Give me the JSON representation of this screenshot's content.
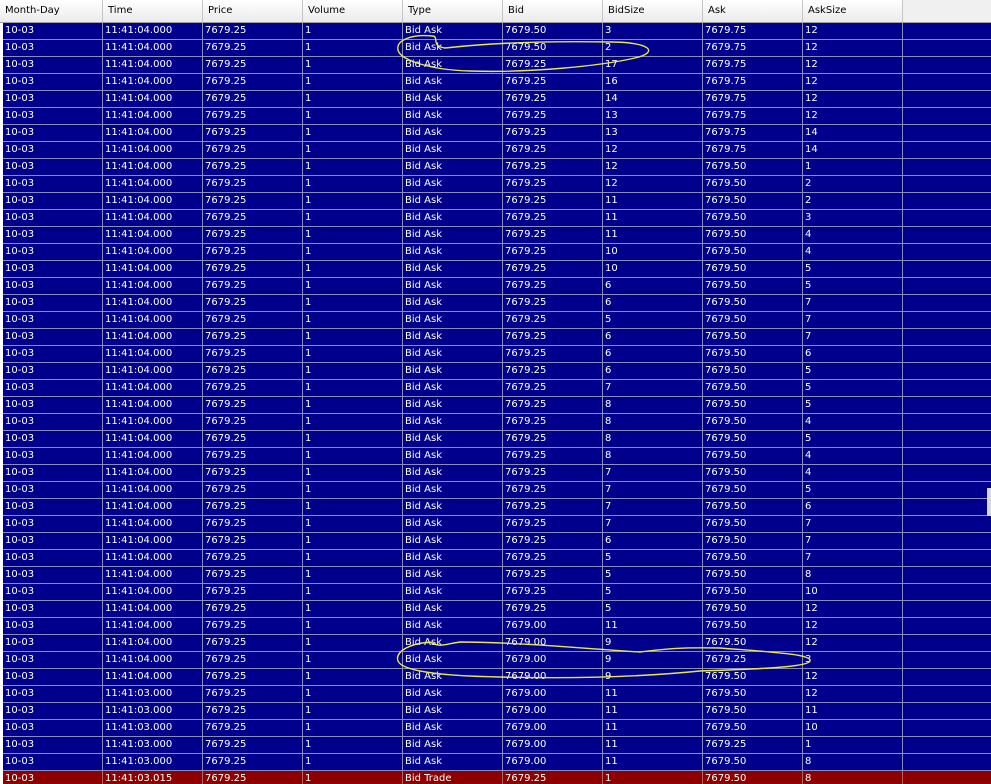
{
  "colors": {
    "row_bg": "#00008c",
    "trade_row_bg": "#8c0000",
    "text": "#ffffff",
    "header_bg": "#f0f0f0",
    "annotation": "#e8e84a"
  },
  "columns": [
    "Month-Day",
    "Time",
    "Price",
    "Volume",
    "Type",
    "Bid",
    "BidSize",
    "Ask",
    "AskSize"
  ],
  "rows": [
    [
      "10-03",
      "11:41:04.000",
      "7679.25",
      "1",
      "Bid Ask",
      "7679.50",
      "3",
      "7679.75",
      "12"
    ],
    [
      "10-03",
      "11:41:04.000",
      "7679.25",
      "1",
      "Bid Ask",
      "7679.50",
      "2",
      "7679.75",
      "12"
    ],
    [
      "10-03",
      "11:41:04.000",
      "7679.25",
      "1",
      "Bid Ask",
      "7679.25",
      "17",
      "7679.75",
      "12"
    ],
    [
      "10-03",
      "11:41:04.000",
      "7679.25",
      "1",
      "Bid Ask",
      "7679.25",
      "16",
      "7679.75",
      "12"
    ],
    [
      "10-03",
      "11:41:04.000",
      "7679.25",
      "1",
      "Bid Ask",
      "7679.25",
      "14",
      "7679.75",
      "12"
    ],
    [
      "10-03",
      "11:41:04.000",
      "7679.25",
      "1",
      "Bid Ask",
      "7679.25",
      "13",
      "7679.75",
      "12"
    ],
    [
      "10-03",
      "11:41:04.000",
      "7679.25",
      "1",
      "Bid Ask",
      "7679.25",
      "13",
      "7679.75",
      "14"
    ],
    [
      "10-03",
      "11:41:04.000",
      "7679.25",
      "1",
      "Bid Ask",
      "7679.25",
      "12",
      "7679.75",
      "14"
    ],
    [
      "10-03",
      "11:41:04.000",
      "7679.25",
      "1",
      "Bid Ask",
      "7679.25",
      "12",
      "7679.50",
      "1"
    ],
    [
      "10-03",
      "11:41:04.000",
      "7679.25",
      "1",
      "Bid Ask",
      "7679.25",
      "12",
      "7679.50",
      "2"
    ],
    [
      "10-03",
      "11:41:04.000",
      "7679.25",
      "1",
      "Bid Ask",
      "7679.25",
      "11",
      "7679.50",
      "2"
    ],
    [
      "10-03",
      "11:41:04.000",
      "7679.25",
      "1",
      "Bid Ask",
      "7679.25",
      "11",
      "7679.50",
      "3"
    ],
    [
      "10-03",
      "11:41:04.000",
      "7679.25",
      "1",
      "Bid Ask",
      "7679.25",
      "11",
      "7679.50",
      "4"
    ],
    [
      "10-03",
      "11:41:04.000",
      "7679.25",
      "1",
      "Bid Ask",
      "7679.25",
      "10",
      "7679.50",
      "4"
    ],
    [
      "10-03",
      "11:41:04.000",
      "7679.25",
      "1",
      "Bid Ask",
      "7679.25",
      "10",
      "7679.50",
      "5"
    ],
    [
      "10-03",
      "11:41:04.000",
      "7679.25",
      "1",
      "Bid Ask",
      "7679.25",
      "6",
      "7679.50",
      "5"
    ],
    [
      "10-03",
      "11:41:04.000",
      "7679.25",
      "1",
      "Bid Ask",
      "7679.25",
      "6",
      "7679.50",
      "7"
    ],
    [
      "10-03",
      "11:41:04.000",
      "7679.25",
      "1",
      "Bid Ask",
      "7679.25",
      "5",
      "7679.50",
      "7"
    ],
    [
      "10-03",
      "11:41:04.000",
      "7679.25",
      "1",
      "Bid Ask",
      "7679.25",
      "6",
      "7679.50",
      "7"
    ],
    [
      "10-03",
      "11:41:04.000",
      "7679.25",
      "1",
      "Bid Ask",
      "7679.25",
      "6",
      "7679.50",
      "6"
    ],
    [
      "10-03",
      "11:41:04.000",
      "7679.25",
      "1",
      "Bid Ask",
      "7679.25",
      "6",
      "7679.50",
      "5"
    ],
    [
      "10-03",
      "11:41:04.000",
      "7679.25",
      "1",
      "Bid Ask",
      "7679.25",
      "7",
      "7679.50",
      "5"
    ],
    [
      "10-03",
      "11:41:04.000",
      "7679.25",
      "1",
      "Bid Ask",
      "7679.25",
      "8",
      "7679.50",
      "5"
    ],
    [
      "10-03",
      "11:41:04.000",
      "7679.25",
      "1",
      "Bid Ask",
      "7679.25",
      "8",
      "7679.50",
      "4"
    ],
    [
      "10-03",
      "11:41:04.000",
      "7679.25",
      "1",
      "Bid Ask",
      "7679.25",
      "8",
      "7679.50",
      "5"
    ],
    [
      "10-03",
      "11:41:04.000",
      "7679.25",
      "1",
      "Bid Ask",
      "7679.25",
      "8",
      "7679.50",
      "4"
    ],
    [
      "10-03",
      "11:41:04.000",
      "7679.25",
      "1",
      "Bid Ask",
      "7679.25",
      "7",
      "7679.50",
      "4"
    ],
    [
      "10-03",
      "11:41:04.000",
      "7679.25",
      "1",
      "Bid Ask",
      "7679.25",
      "7",
      "7679.50",
      "5"
    ],
    [
      "10-03",
      "11:41:04.000",
      "7679.25",
      "1",
      "Bid Ask",
      "7679.25",
      "7",
      "7679.50",
      "6"
    ],
    [
      "10-03",
      "11:41:04.000",
      "7679.25",
      "1",
      "Bid Ask",
      "7679.25",
      "7",
      "7679.50",
      "7"
    ],
    [
      "10-03",
      "11:41:04.000",
      "7679.25",
      "1",
      "Bid Ask",
      "7679.25",
      "6",
      "7679.50",
      "7"
    ],
    [
      "10-03",
      "11:41:04.000",
      "7679.25",
      "1",
      "Bid Ask",
      "7679.25",
      "5",
      "7679.50",
      "7"
    ],
    [
      "10-03",
      "11:41:04.000",
      "7679.25",
      "1",
      "Bid Ask",
      "7679.25",
      "5",
      "7679.50",
      "8"
    ],
    [
      "10-03",
      "11:41:04.000",
      "7679.25",
      "1",
      "Bid Ask",
      "7679.25",
      "5",
      "7679.50",
      "10"
    ],
    [
      "10-03",
      "11:41:04.000",
      "7679.25",
      "1",
      "Bid Ask",
      "7679.25",
      "5",
      "7679.50",
      "12"
    ],
    [
      "10-03",
      "11:41:04.000",
      "7679.25",
      "1",
      "Bid Ask",
      "7679.00",
      "11",
      "7679.50",
      "12"
    ],
    [
      "10-03",
      "11:41:04.000",
      "7679.25",
      "1",
      "Bid Ask",
      "7679.00",
      "9",
      "7679.50",
      "12"
    ],
    [
      "10-03",
      "11:41:04.000",
      "7679.25",
      "1",
      "Bid Ask",
      "7679.00",
      "9",
      "7679.25",
      "3"
    ],
    [
      "10-03",
      "11:41:04.000",
      "7679.25",
      "1",
      "Bid Ask",
      "7679.00",
      "9",
      "7679.50",
      "12"
    ],
    [
      "10-03",
      "11:41:03.000",
      "7679.25",
      "1",
      "Bid Ask",
      "7679.00",
      "11",
      "7679.50",
      "12"
    ],
    [
      "10-03",
      "11:41:03.000",
      "7679.25",
      "1",
      "Bid Ask",
      "7679.00",
      "11",
      "7679.50",
      "11"
    ],
    [
      "10-03",
      "11:41:03.000",
      "7679.25",
      "1",
      "Bid Ask",
      "7679.00",
      "11",
      "7679.50",
      "10"
    ],
    [
      "10-03",
      "11:41:03.000",
      "7679.25",
      "1",
      "Bid Ask",
      "7679.00",
      "11",
      "7679.25",
      "1"
    ],
    [
      "10-03",
      "11:41:03.000",
      "7679.25",
      "1",
      "Bid Ask",
      "7679.00",
      "11",
      "7679.50",
      "8"
    ],
    [
      "10-03",
      "11:41:03.015",
      "7679.25",
      "1",
      "Bid Trade",
      "7679.25",
      "1",
      "7679.50",
      "8"
    ]
  ],
  "trade_rows": [
    44
  ]
}
